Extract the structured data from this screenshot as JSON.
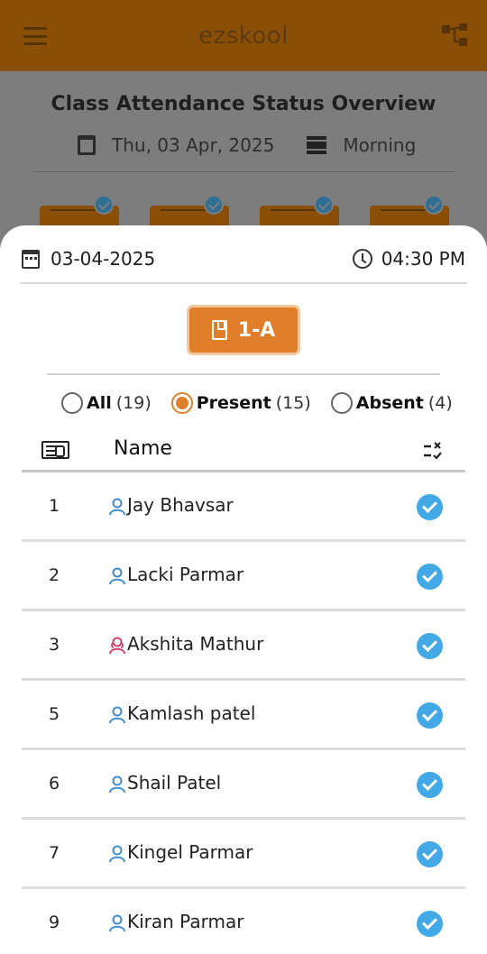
{
  "app": {
    "title": "ezskool",
    "heading": "Class Attendance Status Overview",
    "date_long": "Thu, 03 Apr, 2025",
    "shift": "Morning"
  },
  "sheet": {
    "date": "03-04-2025",
    "time": "04:30 PM",
    "class_label": "1-A",
    "filters": [
      {
        "label": "All",
        "count": "(19)",
        "selected": false
      },
      {
        "label": "Present",
        "count": "(15)",
        "selected": true
      },
      {
        "label": "Absent",
        "count": "(4)",
        "selected": false
      }
    ],
    "table_header": {
      "name": "Name"
    },
    "students": [
      {
        "no": "1",
        "name": "Jay Bhavsar",
        "gender": "male",
        "present": true
      },
      {
        "no": "2",
        "name": "Lacki Parmar",
        "gender": "male",
        "present": true
      },
      {
        "no": "3",
        "name": "Akshita Mathur",
        "gender": "female",
        "present": true
      },
      {
        "no": "5",
        "name": "Kamlash patel",
        "gender": "male",
        "present": true
      },
      {
        "no": "6",
        "name": "Shail Patel",
        "gender": "male",
        "present": true
      },
      {
        "no": "7",
        "name": "Kingel Parmar",
        "gender": "male",
        "present": true
      },
      {
        "no": "9",
        "name": "Kiran Parmar",
        "gender": "male",
        "present": true
      }
    ]
  },
  "colors": {
    "accent": "#e07e29",
    "check": "#42a9e6",
    "male_icon": "#3f8fd0",
    "female_icon": "#d2416a"
  }
}
